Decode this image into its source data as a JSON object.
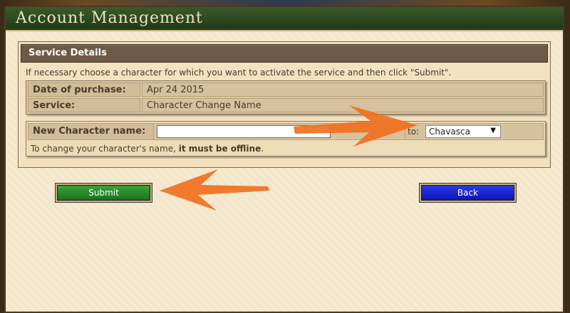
{
  "window": {
    "title": "Account Management"
  },
  "service_box": {
    "heading": "Service Details",
    "instructions": "If necessary choose a character for which you want to activate the service and then click \"Submit\".",
    "rows": [
      {
        "label": "Date of purchase:",
        "value": "Apr 24 2015"
      },
      {
        "label": "Service:",
        "value": "Character Change Name"
      }
    ],
    "new_name": {
      "label": "New Character name:",
      "value": "",
      "to_label": "to:",
      "selected_character": "Chavasca"
    },
    "offline_note_prefix": "To change your character's name,",
    "offline_note_bold": "it must be offline",
    "offline_note_suffix": "."
  },
  "buttons": {
    "submit": "Submit",
    "back": "Back"
  },
  "colors": {
    "title_bar": "#1e3a16",
    "panel_head": "#6e5a48",
    "submit": "#1e8a1e",
    "back": "#1020d0",
    "annotation_arrow": "#f07020"
  },
  "icons": {
    "dropdown": "dropdown-arrow-icon",
    "annotation": "orange-arrow-annotation"
  }
}
